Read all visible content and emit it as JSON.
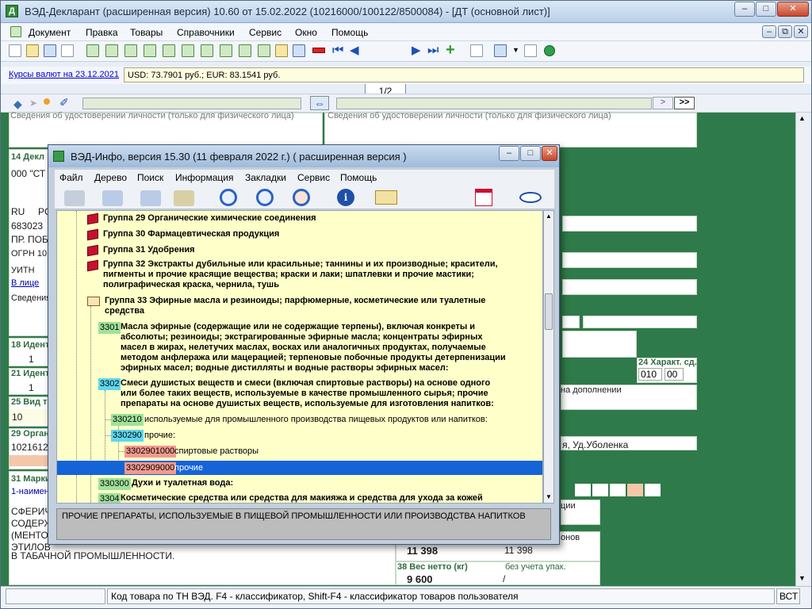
{
  "main_window": {
    "title": "ВЭД-Декларант (расширенная версия) 10.60 от 15.02.2022  (10216000/100122/8500084) - [ДТ (основной лист)]",
    "icon_letter": "Д"
  },
  "menu": [
    "Документ",
    "Правка",
    "Товары",
    "Справочники",
    "Сервис",
    "Окно",
    "Помощь"
  ],
  "toolbar": {
    "page": "1/2"
  },
  "rates": {
    "link": "Курсы валют на 23.12.2021",
    "text": "USD: 73.7901 руб.; EUR: 83.1541 руб."
  },
  "nav": {
    "next_label": ">",
    "last_label": ">>"
  },
  "form": {
    "top_left_text": "Сведения об удостоверении личности (только для физического лица)",
    "top_right_text": "Сведения об удостоверении личности (только для физического лица)",
    "f14_label": "14 Декл",
    "f14_value": "000 \"СТ",
    "country": "RU",
    "country_b": "PO",
    "index": "683023",
    "street": "ПР. ПОБ",
    "ogrn": "ОГРН 10",
    "uitn": "УИТН",
    "in_face": "В лице",
    "info": "Сведения",
    "f18_label": "18 Идент",
    "f18_value": "1",
    "f21_label": "21 Идент",
    "f21_value": "1",
    "f25_label": "25 Вид т",
    "f25_value": "10",
    "f29_label": "29 Орган",
    "f29_value": "1021612",
    "f31_label": "31 Марки",
    "f31_sub": "1-наимен",
    "goods_line1": "СФЕРИЧ",
    "goods_line2": "СОДЕРЖ",
    "goods_line3": "(МЕНТО",
    "goods_line4": "ЭТИЛОВ",
    "goods_line5": "В ТАБАЧНОЙ ПРОМЫШЛЕННОСТИ.",
    "f24_label": "24 Характ. сд.",
    "f24_a": "010",
    "f24_b": "00",
    "addition": "на дополнении",
    "address_right": "я, Уд.Уболенка",
    "customs_note": "ции",
    "kg_note": "онов",
    "gross_a": "11 398",
    "gross_b": "11 398",
    "f38_label": "38 Вес нетто (кг)",
    "f38_hint": "без учета упак.",
    "f38_value": "9 600",
    "f38_slash": "/"
  },
  "status": {
    "hint": "Код товара по ТН ВЭД. F4 - классификатор, Shift-F4 - классификатор товаров пользователя",
    "mode": "ВСТ"
  },
  "info_window": {
    "title": "ВЭД-Инфо, версия 15.30 (11 февраля 2022 г.)  ( расширенная версия )",
    "menu": [
      "Файл",
      "Дерево",
      "Поиск",
      "Информация",
      "Закладки",
      "Сервис",
      "Помощь"
    ],
    "tree": {
      "g29": "Группа 29 Органические химические соединения",
      "g30": "Группа 30 Фармацевтическая продукция",
      "g31": "Группа 31 Удобрения",
      "g32_l1": "Группа 32 Экстракты дубильные или красильные; таннины и их производные; красители,",
      "g32_l2": "пигменты и прочие красящие вещества; краски и лаки; шпатлевки и прочие мастики;",
      "g32_l3": "полиграфическая краска, чернила, тушь",
      "g33_l1": "Группа 33 Эфирные масла и резиноиды; парфюмерные, косметические или туалетные",
      "g33_l2": "средства",
      "c3301_code": "3301",
      "c3301_l1": "Масла эфирные (содержащие или не содержащие терпены), включая конкреты и",
      "c3301_l2": "абсолюты; резиноиды; экстрагированные эфирные масла; концентраты эфирных",
      "c3301_l3": "масел в жирах, нелетучих маслах, восках или аналогичных продуктах, получаемые",
      "c3301_l4": "методом анфлеража или мацерацией; терпеновые побочные продукты детерпенизации",
      "c3301_l5": "эфирных масел; водные дистилляты и водные растворы эфирных масел:",
      "c3302_code": "3302",
      "c3302_l1": "Смеси душистых веществ и смеси (включая спиртовые растворы) на основе одного",
      "c3302_l2": "или более таких веществ, используемые в качестве промышленного сырья; прочие",
      "c3302_l3": "препараты на основе душистых веществ, используемые для изготовления напитков:",
      "c330210_code": "330210",
      "c330210_text": "используемые для промышленного производства пищевых продуктов или напитков:",
      "c330290_code": "330290",
      "c330290_text": "прочие:",
      "c3302901000_code": "3302901000",
      "c3302901000_text": "спиртовые растворы",
      "c3302909000_code": "3302909000",
      "c3302909000_text": "прочие",
      "c330300_code": "330300",
      "c330300_text": "Духи и туалетная вода:",
      "c3304_code": "3304",
      "c3304_text": "Косметические средства или средства для макияжа и средства для ухода за кожей"
    },
    "description": "ПРОЧИЕ ПРЕПАРАТЫ, ИСПОЛЬЗУЕМЫЕ В ПИЩЕВОЙ ПРОМЫШЛЕННОСТИ ИЛИ ПРОИЗВОДСТВА НАПИТКОВ"
  },
  "colors": {
    "form_green": "#2f7a4a",
    "tree_bg": "#ffffc9",
    "selection": "#1464d8"
  }
}
